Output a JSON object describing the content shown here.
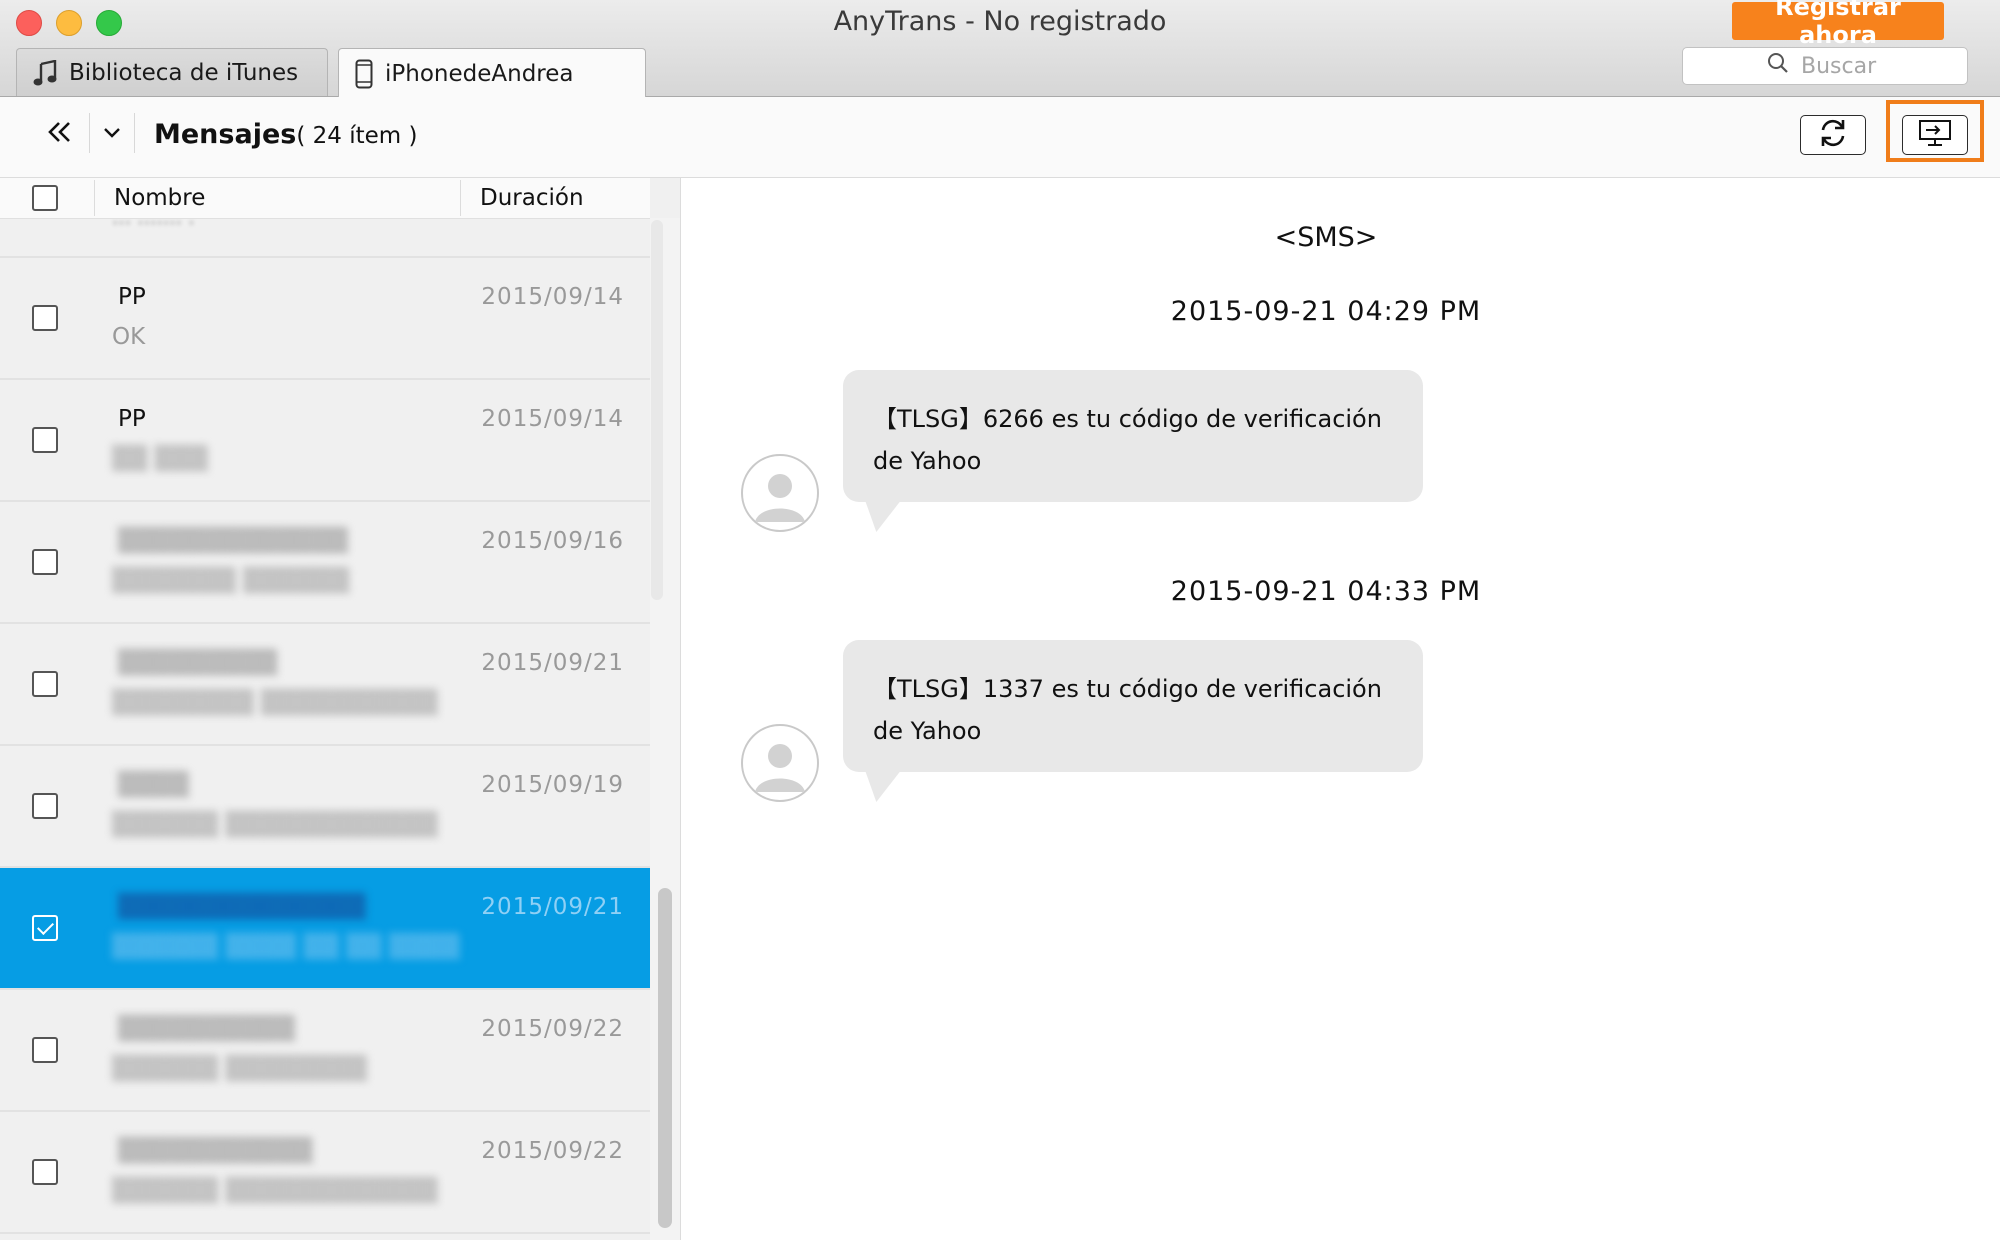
{
  "window": {
    "title": "AnyTrans - No registrado",
    "register_label": "Registrar ahora",
    "search_placeholder": "Buscar"
  },
  "tabs": [
    {
      "label": "Biblioteca de iTunes",
      "icon": "music-note-icon"
    },
    {
      "label": "iPhonedeAndrea",
      "icon": "iphone-icon"
    }
  ],
  "toolbar": {
    "title": "Mensajes",
    "count": "( 24 ítem )",
    "back_icon": "double-chevron-left-icon",
    "dropdown_icon": "chevron-down-icon",
    "refresh_icon": "refresh-icon",
    "export_icon": "export-to-computer-icon"
  },
  "list": {
    "columns": [
      "Nombre",
      "Duración"
    ],
    "rows": [
      {
        "name": "PP",
        "preview": "OK",
        "date": "2015/09/14",
        "checked": false,
        "blurred": false
      },
      {
        "name": "PP",
        "preview": "",
        "date": "2015/09/14",
        "checked": false,
        "blurred": false
      },
      {
        "name": "",
        "preview": "",
        "date": "2015/09/16",
        "checked": false,
        "blurred": true
      },
      {
        "name": "",
        "preview": "",
        "date": "2015/09/21",
        "checked": false,
        "blurred": true
      },
      {
        "name": "",
        "preview": "",
        "date": "2015/09/19",
        "checked": false,
        "blurred": true
      },
      {
        "name": "",
        "preview": "",
        "date": "2015/09/21",
        "checked": true,
        "blurred": true
      },
      {
        "name": "",
        "preview": "",
        "date": "2015/09/22",
        "checked": false,
        "blurred": true
      },
      {
        "name": "",
        "preview": "",
        "date": "2015/09/22",
        "checked": false,
        "blurred": true
      }
    ]
  },
  "conversation": {
    "label": "<SMS>",
    "messages": [
      {
        "timestamp": "2015-09-21 04:29 PM",
        "line1": "【TLSG】6266 es tu código de verificación",
        "line2": "de Yahoo"
      },
      {
        "timestamp": "2015-09-21 04:33 PM",
        "line1": "【TLSG】1337 es tu código de verificación",
        "line2": "de Yahoo"
      }
    ]
  },
  "colors": {
    "accent_orange": "#f7821c",
    "selection_blue": "#069de4"
  }
}
